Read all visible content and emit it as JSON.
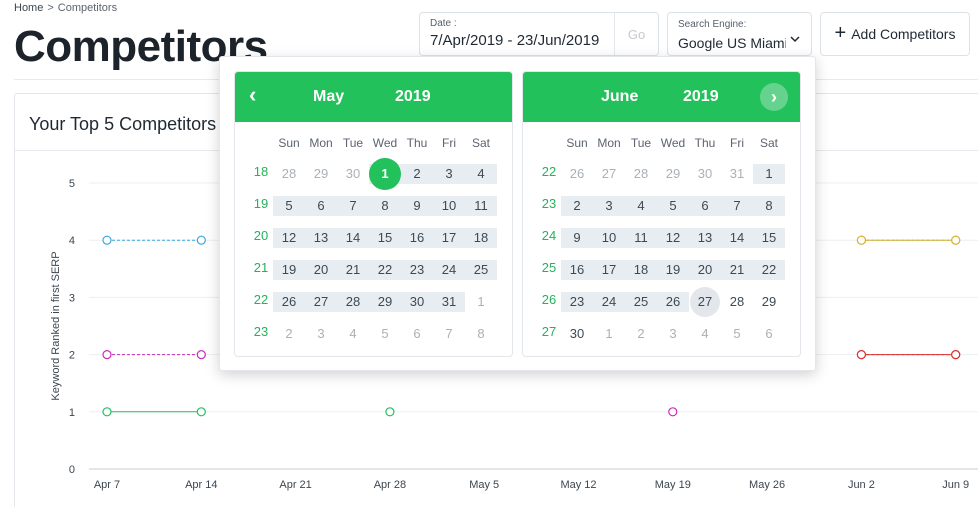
{
  "breadcrumb": {
    "home": "Home",
    "separator": ">",
    "current": "Competitors"
  },
  "page_title": "Competitors",
  "date_filter": {
    "label": "Date :",
    "value": "7/Apr/2019 - 23/Jun/2019",
    "go_label": "Go"
  },
  "search_engine": {
    "label": "Search Engine:",
    "value": "Google US Miami"
  },
  "add_button": {
    "label": "Add Competitors"
  },
  "card": {
    "title": "Your Top 5 Competitors"
  },
  "colors": {
    "accent": "#23c15c",
    "blue": "#3aa6e0",
    "magenta": "#cc2ab8",
    "gold": "#e0b42c",
    "green": "#22c25a",
    "red": "#d9382c"
  },
  "chart_data": {
    "type": "line",
    "ylabel": "Keyword Ranked in first SERP",
    "ylim": [
      0,
      5
    ],
    "yticks": [
      "0",
      "1",
      "2",
      "3",
      "4",
      "5"
    ],
    "categories": [
      "Apr 7",
      "Apr 14",
      "Apr 21",
      "Apr 28",
      "May 5",
      "May 12",
      "May 19",
      "May 26",
      "Jun 2",
      "Jun 9"
    ],
    "series": [
      {
        "color": "#3aa6e0",
        "dashed": true,
        "values": [
          4,
          4,
          null,
          null,
          null,
          null,
          null,
          null,
          4,
          4
        ]
      },
      {
        "color": "#cc2ab8",
        "dashed": true,
        "values": [
          2,
          2,
          null,
          null,
          null,
          null,
          1,
          null,
          2,
          2
        ]
      },
      {
        "color": "#22c25a",
        "dashed": false,
        "values": [
          1,
          1,
          null,
          1,
          null,
          null,
          null,
          null,
          null,
          null
        ]
      },
      {
        "color": "#e0b42c",
        "dashed": false,
        "values": [
          null,
          null,
          null,
          null,
          null,
          null,
          null,
          null,
          4,
          4
        ]
      },
      {
        "color": "#d9382c",
        "dashed": false,
        "values": [
          null,
          null,
          null,
          null,
          null,
          null,
          null,
          null,
          2,
          2
        ]
      }
    ]
  },
  "calendar": {
    "weekdays": [
      "Sun",
      "Mon",
      "Tue",
      "Wed",
      "Thu",
      "Fri",
      "Sat"
    ],
    "prev_icon": "‹",
    "next_icon": "›",
    "months": [
      {
        "name": "May",
        "year": "2019",
        "weeks": [
          {
            "num": "18",
            "days": [
              "28",
              "29",
              "30",
              "1",
              "2",
              "3",
              "4"
            ]
          },
          {
            "num": "19",
            "days": [
              "5",
              "6",
              "7",
              "8",
              "9",
              "10",
              "11"
            ]
          },
          {
            "num": "20",
            "days": [
              "12",
              "13",
              "14",
              "15",
              "16",
              "17",
              "18"
            ]
          },
          {
            "num": "21",
            "days": [
              "19",
              "20",
              "21",
              "22",
              "23",
              "24",
              "25"
            ]
          },
          {
            "num": "22",
            "days": [
              "26",
              "27",
              "28",
              "29",
              "30",
              "31",
              "1"
            ]
          },
          {
            "num": "23",
            "days": [
              "2",
              "3",
              "4",
              "5",
              "6",
              "7",
              "8"
            ]
          }
        ]
      },
      {
        "name": "June",
        "year": "2019",
        "weeks": [
          {
            "num": "22",
            "days": [
              "26",
              "27",
              "28",
              "29",
              "30",
              "31",
              "1"
            ]
          },
          {
            "num": "23",
            "days": [
              "2",
              "3",
              "4",
              "5",
              "6",
              "7",
              "8"
            ]
          },
          {
            "num": "24",
            "days": [
              "9",
              "10",
              "11",
              "12",
              "13",
              "14",
              "15"
            ]
          },
          {
            "num": "25",
            "days": [
              "16",
              "17",
              "18",
              "19",
              "20",
              "21",
              "22"
            ]
          },
          {
            "num": "26",
            "days": [
              "23",
              "24",
              "25",
              "26",
              "27",
              "28",
              "29"
            ]
          },
          {
            "num": "27",
            "days": [
              "30",
              "1",
              "2",
              "3",
              "4",
              "5",
              "6"
            ]
          }
        ]
      }
    ]
  }
}
